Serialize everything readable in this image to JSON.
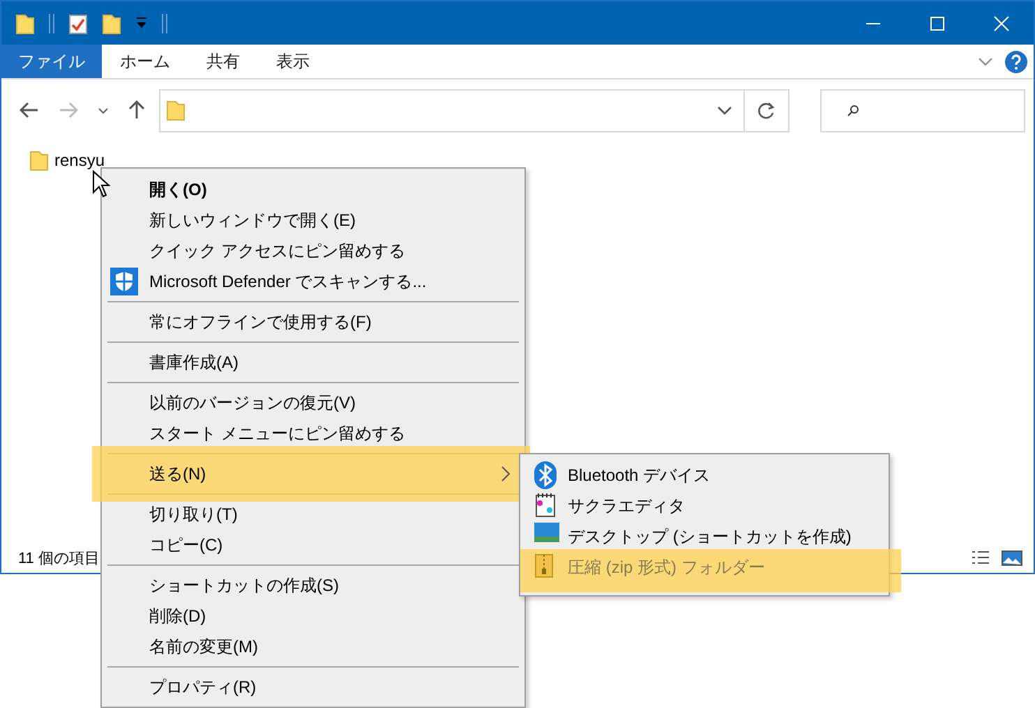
{
  "ribbon": {
    "tabs": [
      {
        "label": "ファイル",
        "selected": true
      },
      {
        "label": "ホーム",
        "selected": false
      },
      {
        "label": "共有",
        "selected": false
      },
      {
        "label": "表示",
        "selected": false
      }
    ]
  },
  "files": [
    {
      "name": "rensyu"
    }
  ],
  "status_bar": {
    "item_count": "11 個の項目"
  },
  "context_menu": {
    "items": [
      {
        "kind": "item",
        "label": "開く(O)",
        "bold": true,
        "highlighted": false
      },
      {
        "kind": "item",
        "label": "新しいウィンドウで開く(E)",
        "bold": false,
        "highlighted": false
      },
      {
        "kind": "item",
        "label": "クイック アクセスにピン留めする",
        "bold": false,
        "highlighted": false
      },
      {
        "kind": "scan",
        "label": "Microsoft Defender でスキャンする...",
        "bold": false,
        "highlighted": false
      },
      {
        "kind": "separator"
      },
      {
        "kind": "item",
        "label": "常にオフラインで使用する(F)",
        "bold": false,
        "highlighted": false
      },
      {
        "kind": "separator"
      },
      {
        "kind": "item",
        "label": "書庫作成(A)",
        "bold": false,
        "highlighted": false
      },
      {
        "kind": "separator"
      },
      {
        "kind": "item",
        "label": "以前のバージョンの復元(V)",
        "bold": false,
        "highlighted": false
      },
      {
        "kind": "item",
        "label": "スタート メニューにピン留めする",
        "bold": false,
        "highlighted": false
      },
      {
        "kind": "separator"
      },
      {
        "kind": "submenu",
        "label": "送る(N)",
        "bold": false,
        "highlighted": true
      },
      {
        "kind": "separator"
      },
      {
        "kind": "item",
        "label": "切り取り(T)",
        "bold": false,
        "highlighted": false
      },
      {
        "kind": "item",
        "label": "コピー(C)",
        "bold": false,
        "highlighted": false
      },
      {
        "kind": "separator"
      },
      {
        "kind": "item",
        "label": "ショートカットの作成(S)",
        "bold": false,
        "highlighted": false
      },
      {
        "kind": "item",
        "label": "削除(D)",
        "bold": false,
        "highlighted": false
      },
      {
        "kind": "item",
        "label": "名前の変更(M)",
        "bold": false,
        "highlighted": false
      },
      {
        "kind": "separator"
      },
      {
        "kind": "item",
        "label": "プロパティ(R)",
        "bold": false,
        "highlighted": false
      }
    ]
  },
  "send_to_menu": {
    "items": [
      {
        "label": "Bluetooth デバイス",
        "highlighted": false
      },
      {
        "label": "サクラエディタ",
        "highlighted": false
      },
      {
        "label": "デスクトップ (ショートカットを作成)",
        "highlighted": false
      },
      {
        "label": "圧縮 (zip 形式) フォルダー",
        "highlighted": true
      }
    ]
  }
}
